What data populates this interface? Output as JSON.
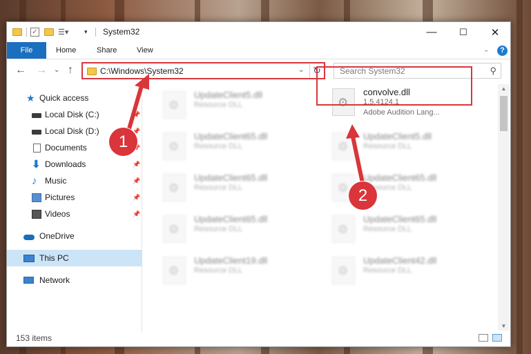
{
  "window": {
    "title": "System32",
    "controls": {
      "minimize": "—",
      "maximize": "☐",
      "close": "✕"
    }
  },
  "ribbon": {
    "tabs": [
      "File",
      "Home",
      "Share",
      "View"
    ],
    "expand_icon": "⌄",
    "help_icon": "?"
  },
  "address": {
    "path": "C:\\Windows\\System32",
    "dropdown_icon": "⌄",
    "refresh_icon": "↻"
  },
  "search": {
    "placeholder": "Search System32",
    "icon": "⚲"
  },
  "nav": {
    "back": "←",
    "forward": "→",
    "recent": "⌄",
    "up": "↑",
    "items": [
      {
        "label": "Quick access",
        "icon": "star-icon",
        "color": "#1c7bd1"
      },
      {
        "label": "Local Disk (C:)",
        "icon": "drive-icon",
        "color": "#3b3b3b"
      },
      {
        "label": "Local Disk (D:)",
        "icon": "drive-icon",
        "color": "#3b3b3b"
      },
      {
        "label": "Documents",
        "icon": "documents-icon",
        "color": "#6b6b6b"
      },
      {
        "label": "Downloads",
        "icon": "downloads-icon",
        "color": "#1c7bd1"
      },
      {
        "label": "Music",
        "icon": "music-icon",
        "color": "#1c7bd1"
      },
      {
        "label": "Pictures",
        "icon": "pictures-icon",
        "color": "#5a8fcf"
      },
      {
        "label": "Videos",
        "icon": "videos-icon",
        "color": "#555"
      },
      {
        "label": "OneDrive",
        "icon": "cloud-icon",
        "color": "#1c6cb8"
      },
      {
        "label": "This PC",
        "icon": "pc-icon",
        "color": "#3a83d0"
      },
      {
        "label": "Network",
        "icon": "network-icon",
        "color": "#3a83d0"
      }
    ],
    "pin_icon": "📌"
  },
  "files": [
    {
      "name": "UpdateClient5.dll",
      "type": "Resource DLL",
      "blurred": true
    },
    {
      "name": "convolve.dll",
      "version": "1.5.4124.1",
      "desc": "Adobe Audition Lang...",
      "blurred": false
    },
    {
      "name": "UpdateClient65.dll",
      "type": "Resource DLL",
      "blurred": true
    },
    {
      "name": "UpdateClient5.dll",
      "type": "Resource DLL",
      "blurred": true
    },
    {
      "name": "UpdateClient65.dll",
      "type": "Resource DLL",
      "blurred": true
    },
    {
      "name": "UpdateClient65.dll",
      "type": "Resource DLL",
      "blurred": true
    },
    {
      "name": "UpdateClient65.dll",
      "type": "Resource DLL",
      "blurred": true
    },
    {
      "name": "UpdateClient65.dll",
      "type": "Resource DLL",
      "blurred": true
    },
    {
      "name": "UpdateClient19.dll",
      "type": "Resource DLL",
      "blurred": true
    },
    {
      "name": "UpdateClient42.dll",
      "type": "Resource DLL",
      "blurred": true
    }
  ],
  "status": {
    "count": "153 items"
  },
  "annotations": {
    "step1": "1",
    "step2": "2",
    "color": "#d9353a"
  }
}
